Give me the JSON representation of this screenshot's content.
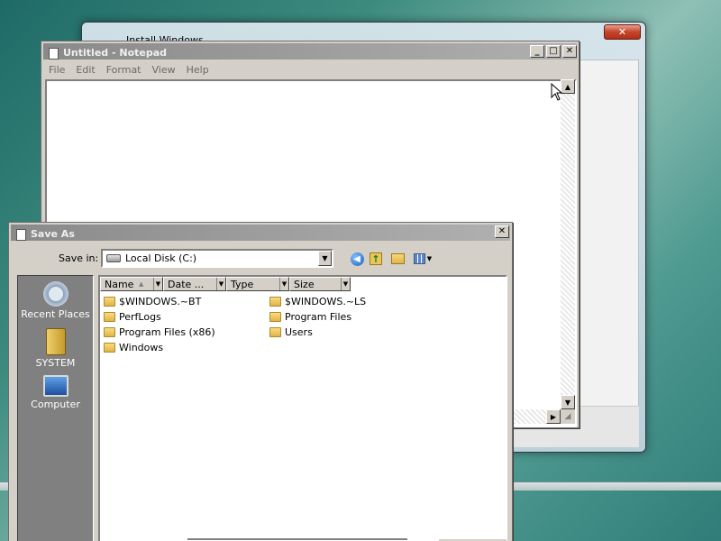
{
  "install_window": {
    "title": "Install Windows",
    "close_label": "✕"
  },
  "notepad": {
    "title": "Untitled - Notepad",
    "menu": [
      "File",
      "Edit",
      "Format",
      "View",
      "Help"
    ],
    "buttons": {
      "minimize": "_",
      "maximize": "□",
      "close": "✕"
    },
    "content": ""
  },
  "save_as": {
    "title": "Save As",
    "close_label": "✕",
    "save_in_label": "Save in:",
    "save_in_value": "Local Disk (C:)",
    "places": [
      "Recent Places",
      "SYSTEM",
      "Computer"
    ],
    "columns": [
      "Name",
      "Date ...",
      "Type",
      "Size"
    ],
    "files": [
      "$WINDOWS.~BT",
      "PerfLogs",
      "Program Files (x86)",
      "Windows",
      "$WINDOWS.~LS",
      "Program Files",
      "Users"
    ]
  }
}
